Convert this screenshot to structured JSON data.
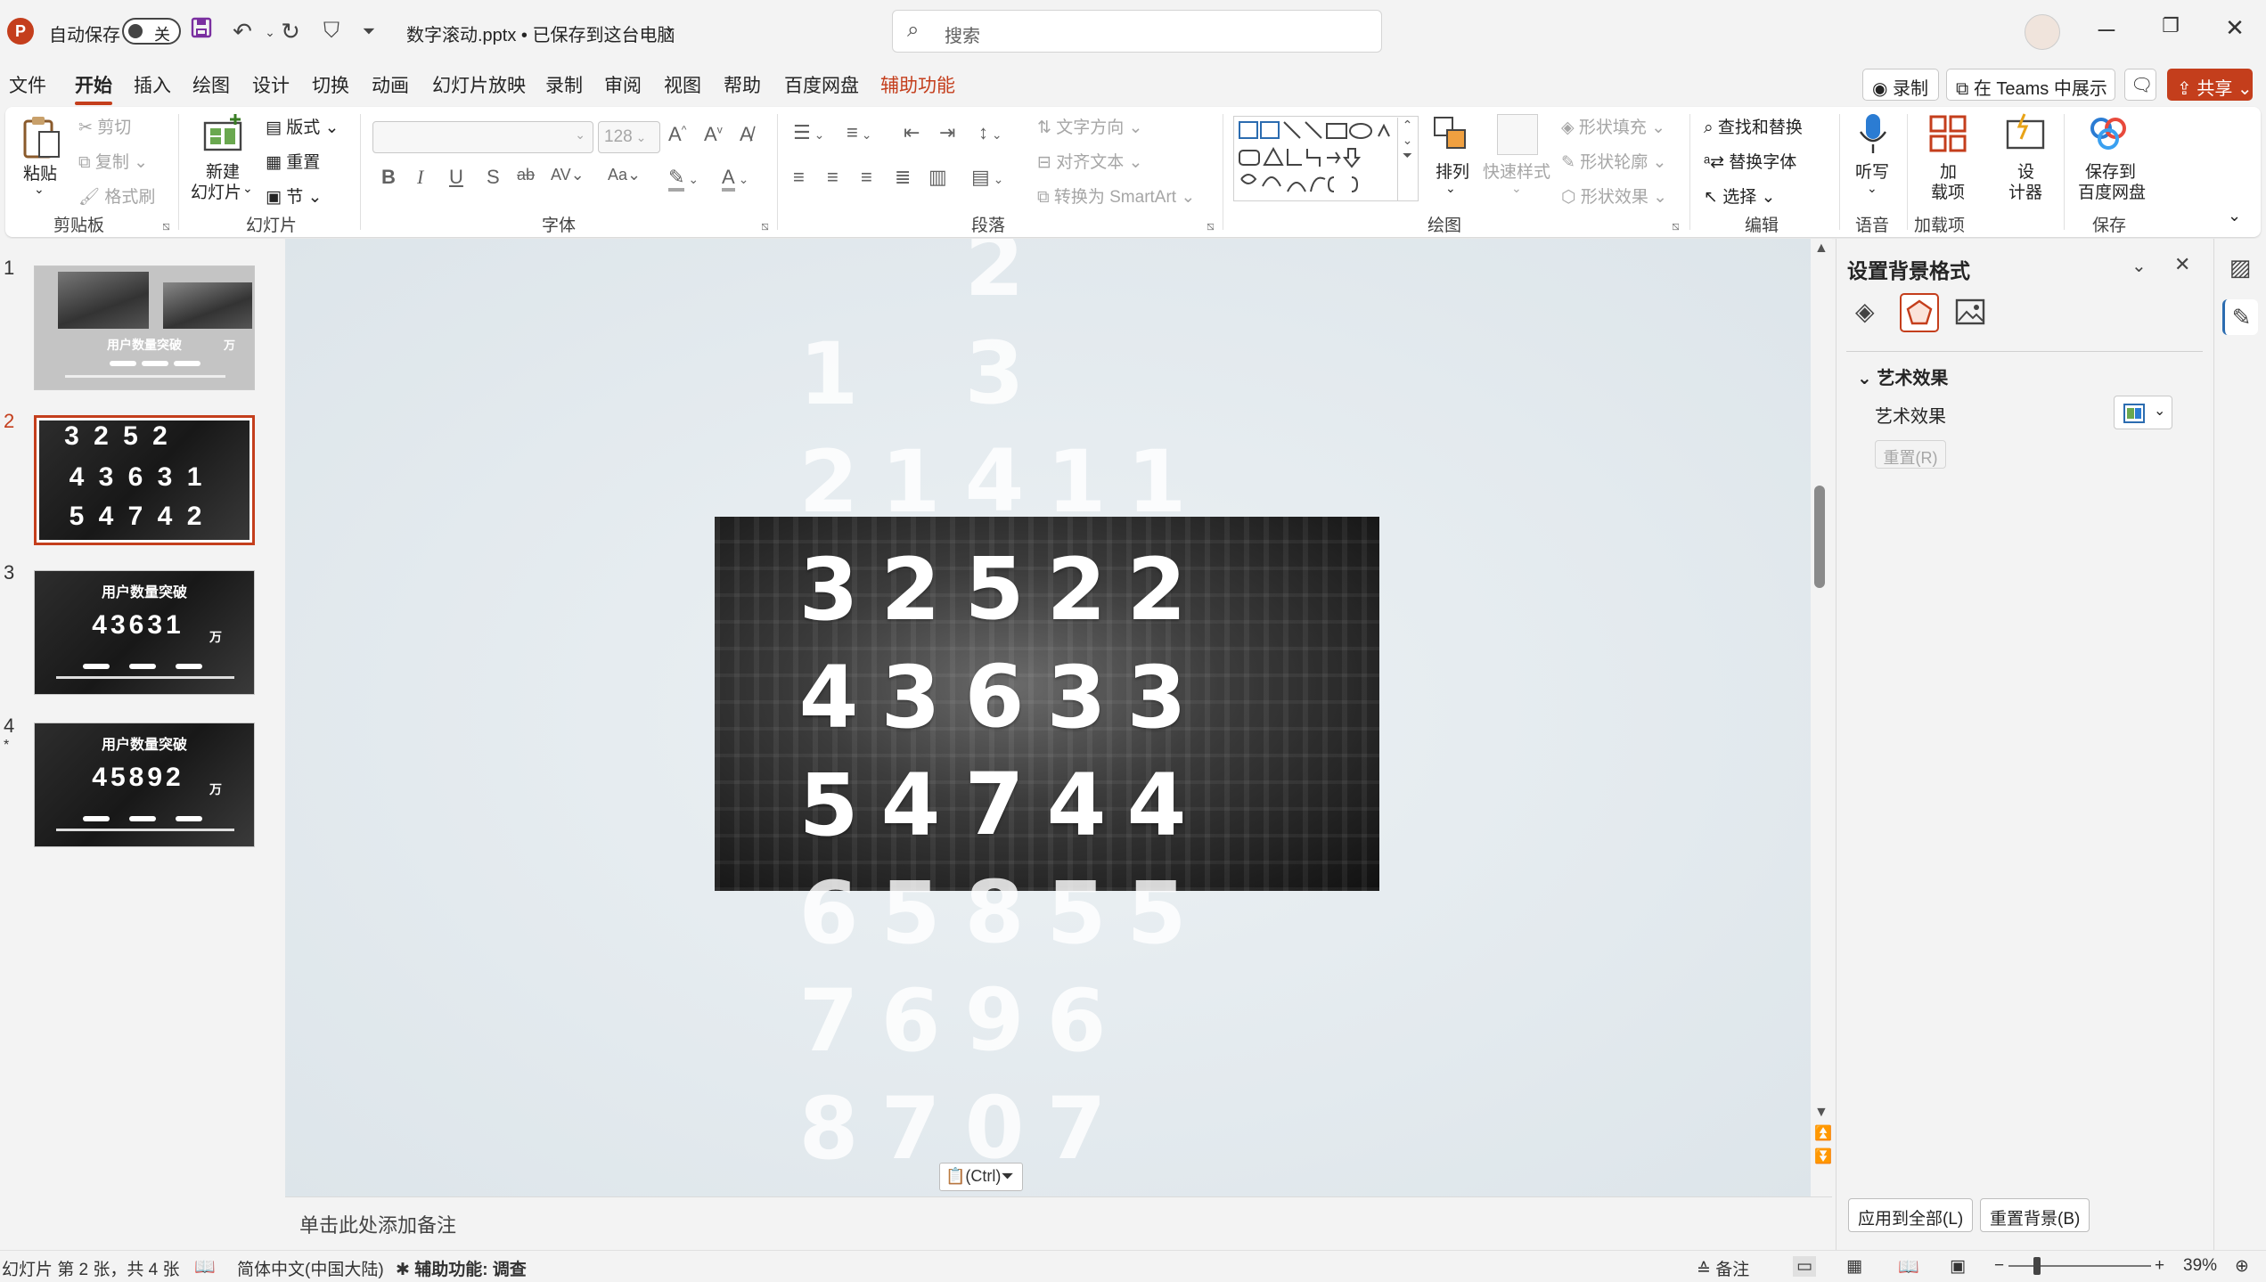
{
  "titlebar": {
    "autosave_label": "自动保存",
    "autosave_state": "关",
    "doc_title": "数字滚动.pptx • 已保存到这台电脑",
    "search_placeholder": "搜索"
  },
  "menu": {
    "tabs": [
      "文件",
      "开始",
      "插入",
      "绘图",
      "设计",
      "切换",
      "动画",
      "幻灯片放映",
      "录制",
      "审阅",
      "视图",
      "帮助",
      "百度网盘",
      "辅助功能"
    ],
    "active": "开始",
    "record": "录制",
    "teams": "在 Teams 中展示",
    "share": "共享"
  },
  "ribbon": {
    "clipboard": {
      "paste": "粘贴",
      "cut": "剪切",
      "copy": "复制",
      "format_painter": "格式刷",
      "group": "剪贴板"
    },
    "slides": {
      "new_slide_1": "新建",
      "new_slide_2": "幻灯片",
      "layout": "版式",
      "reset": "重置",
      "section": "节",
      "group": "幻灯片"
    },
    "font": {
      "size": "128",
      "group": "字体"
    },
    "paragraph": {
      "text_direction": "文字方向",
      "align_text": "对齐文本",
      "smartart": "转换为 SmartArt",
      "group": "段落"
    },
    "drawing": {
      "arrange": "排列",
      "quick_styles": "快速样式",
      "shape_fill": "形状填充",
      "shape_outline": "形状轮廓",
      "shape_effects": "形状效果",
      "group": "绘图"
    },
    "editing": {
      "find_replace": "查找和替换",
      "replace_font": "替换字体",
      "select": "选择",
      "group": "编辑"
    },
    "voice": {
      "dictate": "听写",
      "group": "语音"
    },
    "addins": {
      "label_1": "加",
      "label_2": "载项",
      "group": "加载项"
    },
    "designer": {
      "label_1": "设",
      "label_2": "计器"
    },
    "save": {
      "label_1": "保存到",
      "label_2": "百度网盘",
      "group": "保存"
    }
  },
  "thumbnails": [
    {
      "num": "1",
      "title": "用户数量突破",
      "unit": "万"
    },
    {
      "num": "2",
      "rows": [
        "3 2 5 2",
        "4 3 6 3 1",
        "5 4 7 4 2"
      ]
    },
    {
      "num": "3",
      "title": "用户数量突破",
      "number": "43631",
      "unit": "万"
    },
    {
      "num": "4",
      "star": "*",
      "title": "用户数量突破",
      "number": "45892",
      "unit": "万"
    }
  ],
  "slide_digits": {
    "columns": [
      [
        "1",
        "2",
        "3",
        "4",
        "5",
        "6",
        "7",
        "8"
      ],
      [
        "1",
        "2",
        "3",
        "4",
        "5",
        "6",
        "7"
      ],
      [
        "2",
        "3",
        "4",
        "5",
        "6",
        "7",
        "8",
        "9",
        "0"
      ],
      [
        "1",
        "2",
        "3",
        "4",
        "5",
        "6",
        "7"
      ],
      [
        "1",
        "2",
        "3",
        "4",
        "5"
      ]
    ]
  },
  "paste_options": "(Ctrl)",
  "notes_placeholder": "单击此处添加备注",
  "format_panel": {
    "title": "设置背景格式",
    "section": "艺术效果",
    "property": "艺术效果",
    "reset": "重置(R)",
    "apply_all": "应用到全部(L)",
    "reset_bg": "重置背景(B)"
  },
  "status": {
    "slide_info": "幻灯片 第 2 张，共 4 张",
    "language": "简体中文(中国大陆)",
    "accessibility": "辅助功能: 调查",
    "notes": "备注",
    "zoom": "39%"
  },
  "colors": {
    "accent": "#c43e1c",
    "ribbon_bg": "#ffffff",
    "window_bg": "#f3f3f3"
  }
}
